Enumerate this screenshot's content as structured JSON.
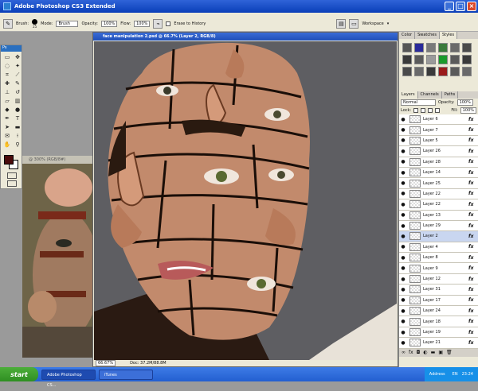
{
  "window": {
    "title": "Adobe Photoshop CS3 Extended",
    "minimize": "_",
    "maximize": "□",
    "close": "×"
  },
  "options": {
    "brush_label": "Brush:",
    "brush_size": "25",
    "mode_label": "Mode:",
    "mode_value": "Brush",
    "opacity_label": "Opacity:",
    "opacity_value": "100%",
    "flow_label": "Flow:",
    "flow_value": "100%",
    "erase_history_label": "Erase to History",
    "workspace_label": "Workspace"
  },
  "toolbox": {
    "badge": "Ps"
  },
  "bg_window": {
    "title": "@ 300% (RGB/8#)"
  },
  "document": {
    "title": "face manipulation 2.psd @ 66.7% (Layer 2, RGB/8)",
    "zoom": "66.67%",
    "doc_size": "Doc: 37.2M/88.8M"
  },
  "panels": {
    "top_tabs": [
      "Color",
      "Swatches",
      "Styles"
    ],
    "style_colors": [
      "#555555",
      "#2a2a9a",
      "#7a7a7a",
      "#3a7a3a",
      "#6a6a6a",
      "#4a4a4a",
      "#3a3a3a",
      "#5a5a5a",
      "#9a9a9a",
      "#1a9a2a",
      "#5a5a5a",
      "#3a3a3a",
      "#4a4a4a",
      "#6a6a6a",
      "#3a3a3a",
      "#9a1a1a",
      "#5a5a5a",
      "#6a6a6a"
    ],
    "layer_tabs": [
      "Layers",
      "Channels",
      "Paths"
    ],
    "blend_mode": "Normal",
    "opacity_label": "Opacity:",
    "opacity_value": "100%",
    "lock_label": "Lock:",
    "fill_label": "Fill:",
    "fill_value": "100%",
    "layers": [
      {
        "name": "Layer 6",
        "selected": false
      },
      {
        "name": "Layer 7",
        "selected": false
      },
      {
        "name": "Layer 5",
        "selected": false
      },
      {
        "name": "Layer 26",
        "selected": false
      },
      {
        "name": "Layer 28",
        "selected": false
      },
      {
        "name": "Layer 14",
        "selected": false
      },
      {
        "name": "Layer 25",
        "selected": false
      },
      {
        "name": "Layer 22",
        "selected": false
      },
      {
        "name": "Layer 22",
        "selected": false
      },
      {
        "name": "Layer 13",
        "selected": false
      },
      {
        "name": "Layer 29",
        "selected": false
      },
      {
        "name": "Layer 2",
        "selected": true
      },
      {
        "name": "Layer 4",
        "selected": false
      },
      {
        "name": "Layer 8",
        "selected": false
      },
      {
        "name": "Layer 9",
        "selected": false
      },
      {
        "name": "Layer 12",
        "selected": false
      },
      {
        "name": "Layer 31",
        "selected": false
      },
      {
        "name": "Layer 17",
        "selected": false
      },
      {
        "name": "Layer 24",
        "selected": false
      },
      {
        "name": "Layer 18",
        "selected": false
      },
      {
        "name": "Layer 19",
        "selected": false
      },
      {
        "name": "Layer 21",
        "selected": false
      }
    ],
    "fx_label": "fx",
    "eye_glyph": "●"
  },
  "taskbar": {
    "start_label": "start",
    "tasks": [
      "Adobe Photoshop CS...",
      "iTunes"
    ],
    "address_label": "Address",
    "lang": "EN",
    "clock": "23:24"
  }
}
